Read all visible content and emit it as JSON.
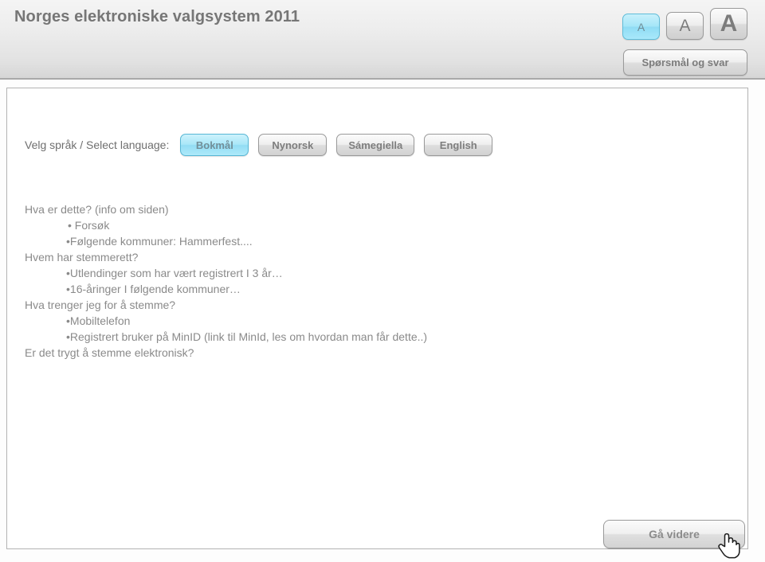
{
  "header": {
    "title": "Norges elektroniske valgsystem 2011",
    "text_size_buttons": [
      {
        "label": "A",
        "name": "text-size-small",
        "selected": true
      },
      {
        "label": "A",
        "name": "text-size-medium",
        "selected": false
      },
      {
        "label": "A",
        "name": "text-size-large",
        "selected": false
      }
    ],
    "qa_button_label": "Spørsmål og svar",
    "accent_selected_color": "#a5e6f8",
    "text_color": "#767676"
  },
  "language": {
    "label": "Velg språk / Select language:",
    "options": [
      {
        "label": "Bokmål",
        "selected": true
      },
      {
        "label": "Nynorsk",
        "selected": false
      },
      {
        "label": "Sámegiella",
        "selected": false
      },
      {
        "label": "English",
        "selected": false
      }
    ]
  },
  "info": {
    "lines": [
      {
        "text": "Hva er dette?  (info om siden)",
        "level": 1
      },
      {
        "text": "• Forsøk",
        "level": 2
      },
      {
        "text": "•Følgende kommuner: Hammerfest....",
        "level": 2
      },
      {
        "text": "Hvem har stemmerett?",
        "level": 1
      },
      {
        "text": "•Utlendinger som har vært registrert I 3 år…",
        "level": 2
      },
      {
        "text": "•16-åringer I følgende kommuner…",
        "level": 2
      },
      {
        "text": "Hva trenger jeg for å stemme?",
        "level": 1
      },
      {
        "text": "•Mobiltelefon",
        "level": 2
      },
      {
        "text": "•Registrert bruker på MinID (link til MinId, les om hvordan man får dette..)",
        "level": 2
      },
      {
        "text": "Er det trygt å stemme elektronisk?",
        "level": 1
      }
    ]
  },
  "footer": {
    "forward_label": "Gå videre"
  },
  "cursor": {
    "icon": "pointing-hand-cursor"
  }
}
